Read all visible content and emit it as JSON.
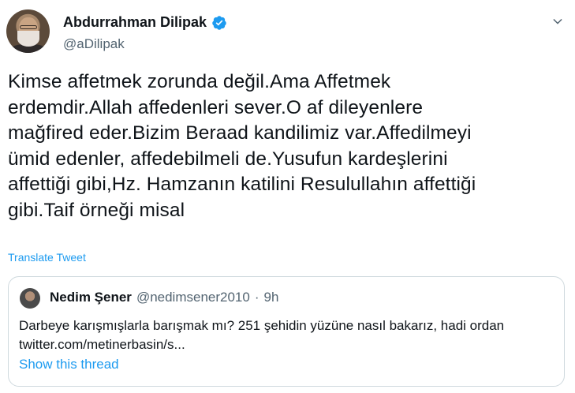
{
  "author": {
    "display_name": "Abdurrahman Dilipak",
    "handle": "@aDilipak",
    "verified": true
  },
  "tweet": {
    "text_lines": [
      "Kimse affetmek zorunda değil.Ama Affetmek",
      "erdemdir.Allah affedenleri sever.O af dileyenlere",
      "mağfired eder.Bizim Beraad kandilimiz var.Affedilmeyi",
      "ümid edenler, affedebilmeli de.Yusufun kardeşlerini",
      "affettiği gibi,Hz. Hamzanın katilini Resulullahın affettiği",
      "gibi.Taif örneği misal"
    ],
    "translate_label": "Translate Tweet"
  },
  "quote": {
    "display_name": "Nedim Şener",
    "handle": "@nedimsener2010",
    "separator": "·",
    "time": "9h",
    "text": "Darbeye karışmışlarla barışmak mı? 251 şehidin yüzüne nasıl bakarız, hadi ordan",
    "link": "twitter.com/metinerbasin/s...",
    "show_thread_label": "Show this thread"
  },
  "icons": {
    "verified": "verified-badge-icon",
    "menu": "chevron-down-icon"
  },
  "colors": {
    "accent": "#1d9bf0",
    "text": "#0f1419",
    "muted": "#536471",
    "border": "#cfd9de"
  }
}
